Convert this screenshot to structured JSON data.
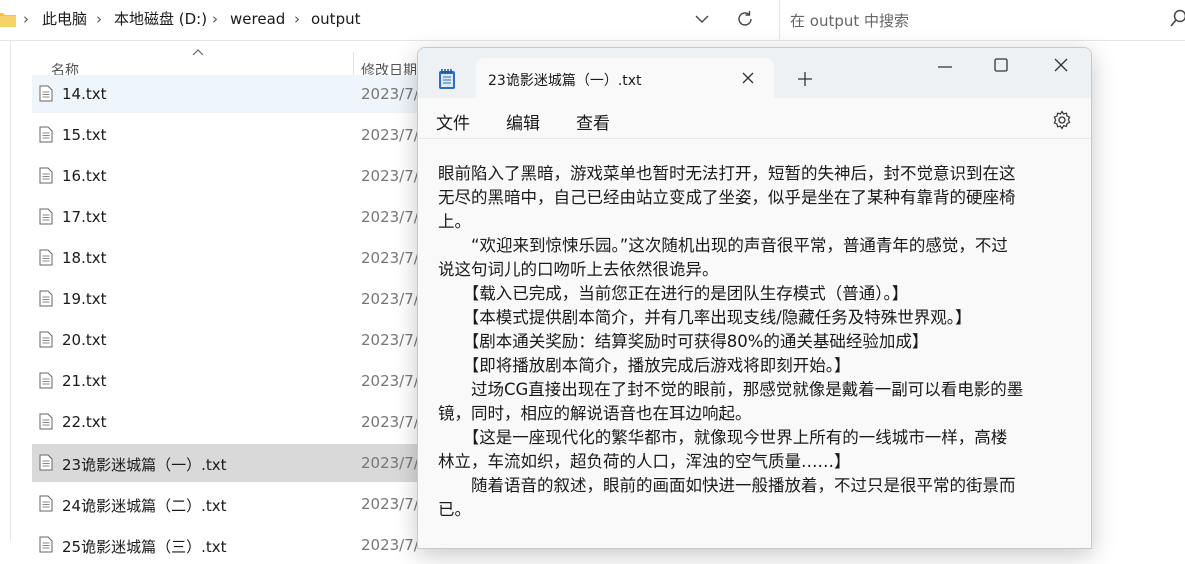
{
  "explorer": {
    "breadcrumb": [
      "此电脑",
      "本地磁盘 (D:)",
      "weread",
      "output"
    ],
    "search_placeholder": "在 output 中搜索",
    "columns": {
      "name": "名称",
      "modified": "修改日期"
    },
    "files": [
      {
        "name": "14.txt",
        "date": "2023/7/"
      },
      {
        "name": "15.txt",
        "date": "2023/7/"
      },
      {
        "name": "16.txt",
        "date": "2023/7/"
      },
      {
        "name": "17.txt",
        "date": "2023/7/"
      },
      {
        "name": "18.txt",
        "date": "2023/7/"
      },
      {
        "name": "19.txt",
        "date": "2023/7/"
      },
      {
        "name": "20.txt",
        "date": "2023/7/"
      },
      {
        "name": "21.txt",
        "date": "2023/7/"
      },
      {
        "name": "22.txt",
        "date": "2023/7/"
      },
      {
        "name": "23诡影迷城篇（一）.txt",
        "date": "2023/7/"
      },
      {
        "name": "24诡影迷城篇（二）.txt",
        "date": "2023/7/"
      },
      {
        "name": "25诡影迷城篇（三）.txt",
        "date": "2023/7/"
      }
    ],
    "selected_file": "23诡影迷城篇（一）.txt"
  },
  "notepad": {
    "tab_title": "23诡影迷城篇（一）.txt",
    "menu": [
      "文件",
      "编辑",
      "查看"
    ],
    "lines": [
      "眼前陷入了黑暗，游戏菜单也暂时无法打开，短暂的失神后，封不觉意识到在这",
      "无尽的黑暗中，自己已经由站立变成了坐姿，似乎是坐在了某种有靠背的硬座椅",
      "上。",
      "　　“欢迎来到惊悚乐园。”这次随机出现的声音很平常，普通青年的感觉，不过",
      "说这句词儿的口吻听上去依然很诡异。",
      "　　【载入已完成，当前您正在进行的是团队生存模式（普通）。】",
      "　　【本模式提供剧本简介，并有几率出现支线/隐藏任务及特殊世界观。】",
      "　　【剧本通关奖励：结算奖励时可获得80%的通关基础经验加成】",
      "　　【即将播放剧本简介，播放完成后游戏将即刻开始。】",
      "　　过场CG直接出现在了封不觉的眼前，那感觉就像是戴着一副可以看电影的墨",
      "镜，同时，相应的解说语音也在耳边响起。",
      "　　【这是一座现代化的繁华都市，就像现今世界上所有的一线城市一样，高楼",
      "林立，车流如织，超负荷的人口，浑浊的空气质量……】",
      "　　随着语音的叙述，眼前的画面如快进一般播放着，不过只是很平常的街景而",
      "已。"
    ]
  },
  "colors": {
    "accent_folder": "#f2c14e",
    "selected_row": "#d9d9d9",
    "notepad_icon": "#2f6fb5"
  }
}
